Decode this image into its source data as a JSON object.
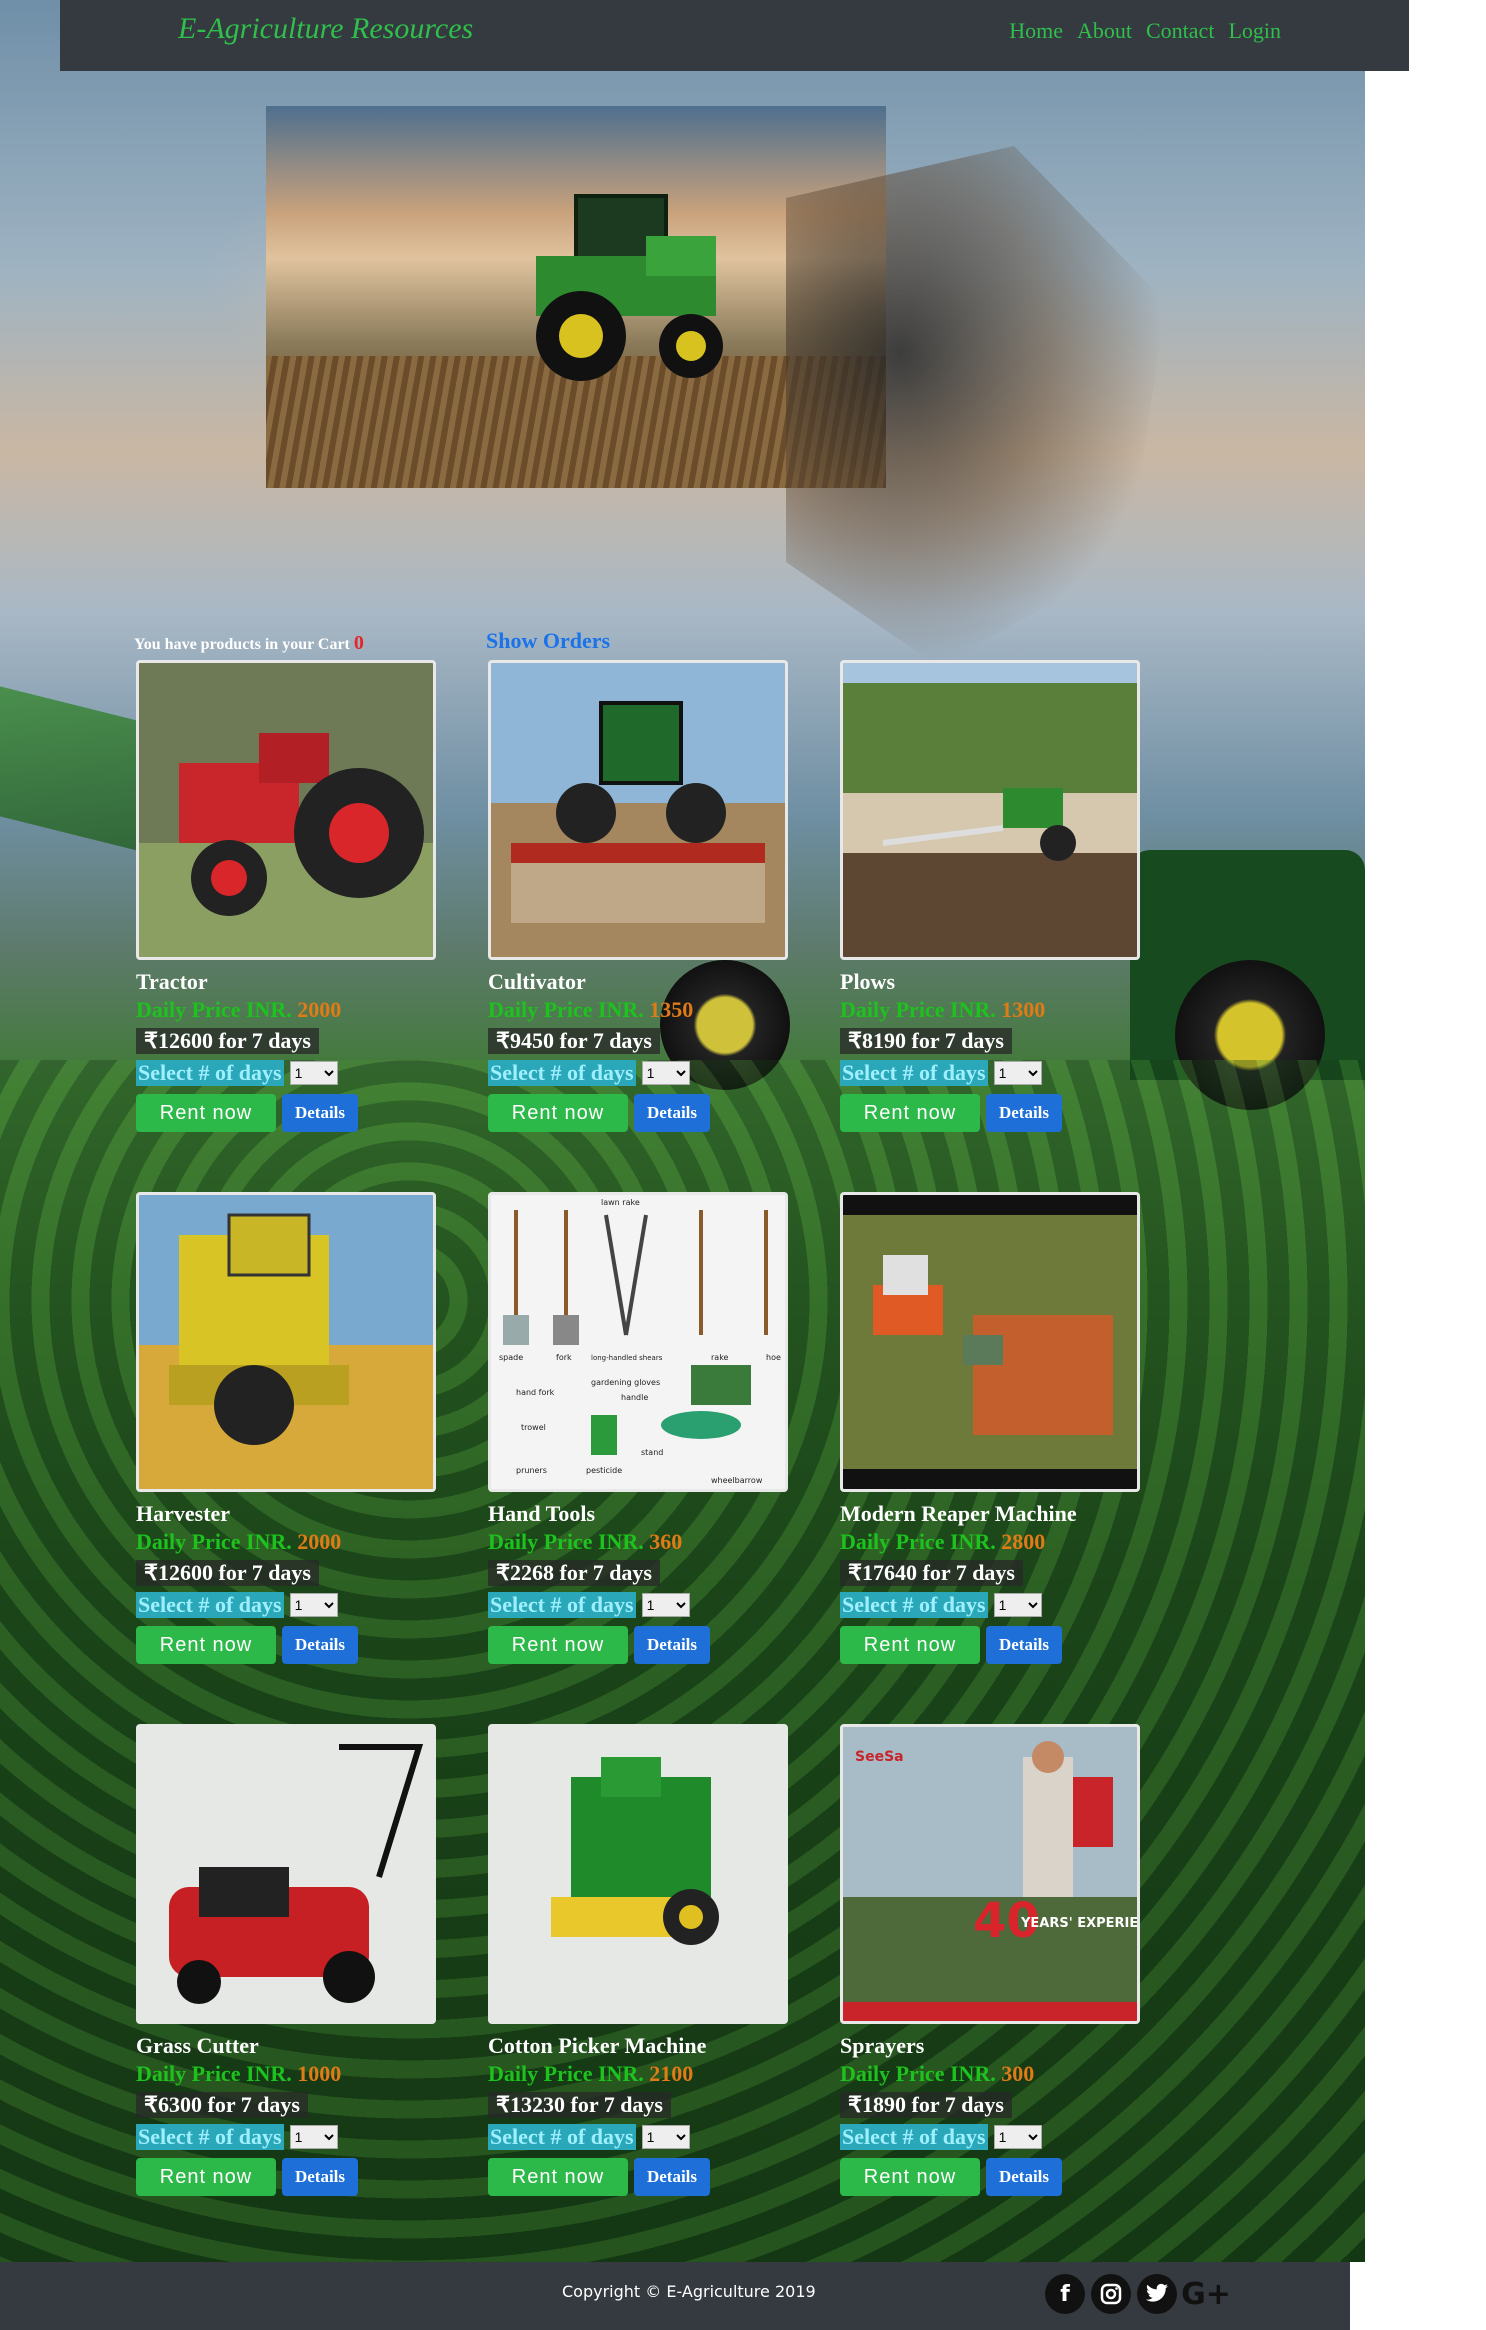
{
  "navbar": {
    "brand": "E-Agriculture Resources",
    "links": [
      "Home",
      "About",
      "Contact",
      "Login"
    ]
  },
  "cart": {
    "label": "You have products in your Cart",
    "count": "0",
    "show_orders": "Show Orders"
  },
  "products": [
    {
      "name": "Tractor",
      "price_label": "Daily Price INR.",
      "price": "2000",
      "total": "₹12600 for 7 days",
      "days_label": "Select # of days",
      "days_value": "1",
      "rent": "Rent now",
      "details": "Details"
    },
    {
      "name": "Cultivator",
      "price_label": "Daily Price INR.",
      "price": "1350",
      "total": "₹9450 for 7 days",
      "days_label": "Select # of days",
      "days_value": "1",
      "rent": "Rent now",
      "details": "Details"
    },
    {
      "name": "Plows",
      "price_label": "Daily Price INR.",
      "price": "1300",
      "total": "₹8190 for 7 days",
      "days_label": "Select # of days",
      "days_value": "1",
      "rent": "Rent now",
      "details": "Details"
    },
    {
      "name": "Harvester",
      "price_label": "Daily Price INR.",
      "price": "2000",
      "total": "₹12600 for 7 days",
      "days_label": "Select # of days",
      "days_value": "1",
      "rent": "Rent now",
      "details": "Details"
    },
    {
      "name": "Hand Tools",
      "price_label": "Daily Price INR.",
      "price": "360",
      "total": "₹2268 for 7 days",
      "days_label": "Select # of days",
      "days_value": "1",
      "rent": "Rent now",
      "details": "Details"
    },
    {
      "name": "Modern Reaper Machine",
      "price_label": "Daily Price INR.",
      "price": "2800",
      "total": "₹17640 for 7 days",
      "days_label": "Select # of days",
      "days_value": "1",
      "rent": "Rent now",
      "details": "Details"
    },
    {
      "name": "Grass Cutter",
      "price_label": "Daily Price INR.",
      "price": "1000",
      "total": "₹6300 for 7 days",
      "days_label": "Select # of days",
      "days_value": "1",
      "rent": "Rent now",
      "details": "Details"
    },
    {
      "name": "Cotton Picker Machine",
      "price_label": "Daily Price INR.",
      "price": "2100",
      "total": "₹13230 for 7 days",
      "days_label": "Select # of days",
      "days_value": "1",
      "rent": "Rent now",
      "details": "Details"
    },
    {
      "name": "Sprayers",
      "price_label": "Daily Price INR.",
      "price": "300",
      "total": "₹1890 for 7 days",
      "days_label": "Select # of days",
      "days_value": "1",
      "rent": "Rent now",
      "details": "Details"
    }
  ],
  "hand_tools_labels": [
    "lawn rake",
    "spade",
    "fork",
    "long-handled shears",
    "rake",
    "hoe",
    "hand fork",
    "gardening gloves",
    "handle",
    "trowel",
    "stand",
    "pruners",
    "pesticide",
    "wheelbarrow"
  ],
  "sprayer_poster": {
    "brand": "SeeSa",
    "years": "40",
    "tagline": "YEARS' EXPERIENCE"
  },
  "footer": {
    "copyright": "Copyright © E-Agriculture 2019",
    "social": [
      "facebook-icon",
      "instagram-icon",
      "twitter-icon",
      "google-plus-icon"
    ]
  },
  "colors": {
    "nav_bg": "#343a40",
    "brand_green": "#2fbf4a",
    "price_green": "#1ec21e",
    "price_orange": "#e07b16",
    "rent_green": "#2db84a",
    "details_blue": "#1e6fd8",
    "orders_blue": "#1a73e8",
    "cart_red": "#e4262b"
  }
}
